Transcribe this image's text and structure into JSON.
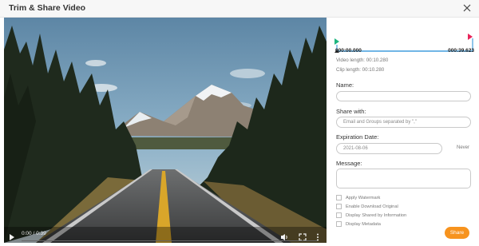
{
  "dialog": {
    "title": "Trim & Share Video",
    "close_icon": "close-icon"
  },
  "player": {
    "time_display": "0:00 / 0:39",
    "progress": 0,
    "icons": [
      "play-icon",
      "volume-icon",
      "fullscreen-icon",
      "more-options-icon"
    ]
  },
  "trim": {
    "start_time": "000:00.000",
    "end_time": "000:39.623",
    "video_length": "Video length: 00:10.280",
    "clip_length": "Clip length: 00:10.280",
    "colors": {
      "start": "#1db57f",
      "end": "#e8245a",
      "track": "#1c8bd6"
    }
  },
  "form": {
    "name_label": "Name:",
    "name_value": "",
    "share_with_label": "Share with:",
    "share_with_placeholder": "Email and Groups separated by \",\"",
    "expiration_label": "Expiration Date:",
    "expiration_value": "2021-08-06",
    "never_label": "Never",
    "message_label": "Message:",
    "message_value": ""
  },
  "options": [
    {
      "label": "Apply Watermark",
      "checked": false
    },
    {
      "label": "Enable Download Original",
      "checked": false
    },
    {
      "label": "Display Shared by Information",
      "checked": false
    },
    {
      "label": "Display Metadata",
      "checked": false
    }
  ],
  "share_button": {
    "label": "Share",
    "color": "#f7931e"
  }
}
